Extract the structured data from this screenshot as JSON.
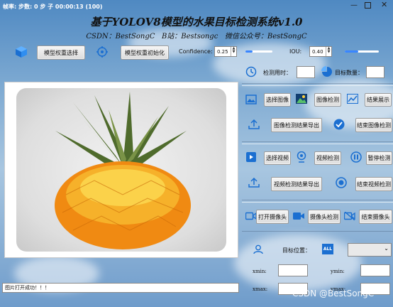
{
  "window": {
    "title": "帧率: 步数: 0 步 子 00:00:13 (100)"
  },
  "header": {
    "title": "基于YOLOV8模型的水果目标检测系统v1.0",
    "subtitle": "CSDN：BestSongC   B站：Bestsongc   微信公众号：BestSongC"
  },
  "toolbar": {
    "model_select_label": "模型权重选择",
    "model_init_label": "模型权重初始化",
    "confidence_label": "Confidence:",
    "confidence_value": "0.25",
    "confidence_level": 0.25,
    "iou_label": "IOU:",
    "iou_value": "0.40",
    "iou_level": 0.4
  },
  "stats": {
    "time_label": "检测用时：",
    "time_value": "",
    "count_label": "目标数量：",
    "count_value": ""
  },
  "image_section": {
    "select_label": "选择图像",
    "detect_label": "图像检测",
    "show_label": "结果展示",
    "export_label": "图像检测结果导出",
    "end_label": "结束图像检测"
  },
  "video_section": {
    "select_label": "选择视频",
    "detect_label": "视频检测",
    "pause_label": "暂停检测",
    "export_label": "视频检测结果导出",
    "end_label": "结束视频检测"
  },
  "camera_section": {
    "open_label": "打开摄像头",
    "detect_label": "摄像头检测",
    "end_label": "结束摄像头"
  },
  "target_section": {
    "position_label": "目标位置：",
    "all_badge": "ALL",
    "select_value": "",
    "xmin_label": "xmin:",
    "ymin_label": "ymin:",
    "xmax_label": "xmax:",
    "ymax_label": "ymax:"
  },
  "status": {
    "message": "图片打开成功！！！"
  },
  "watermark": "CSDN @BestSongC"
}
